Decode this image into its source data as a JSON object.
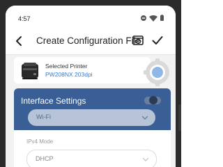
{
  "status_bar": {
    "time": "4:57",
    "icons": [
      "dnd-icon",
      "wifi-icon",
      "battery-icon"
    ]
  },
  "app_bar": {
    "title": "Create Configuration File",
    "back_icon": "back-arrow-icon",
    "preview_icon": "preview-icon",
    "save_icon": "checkmark-icon"
  },
  "printer": {
    "label": "Selected Printer",
    "model": "PW208NX 203dpi"
  },
  "interface_settings": {
    "title": "Interface Settings",
    "toggle_on": false,
    "connection_type": "Wi-Fi",
    "ipv4_mode_label": "IPv4 Mode",
    "ipv4_mode_value": "DHCP"
  },
  "colors": {
    "accent": "#3a5f96",
    "link": "#2e7bd8",
    "background": "#f2f2f2"
  }
}
